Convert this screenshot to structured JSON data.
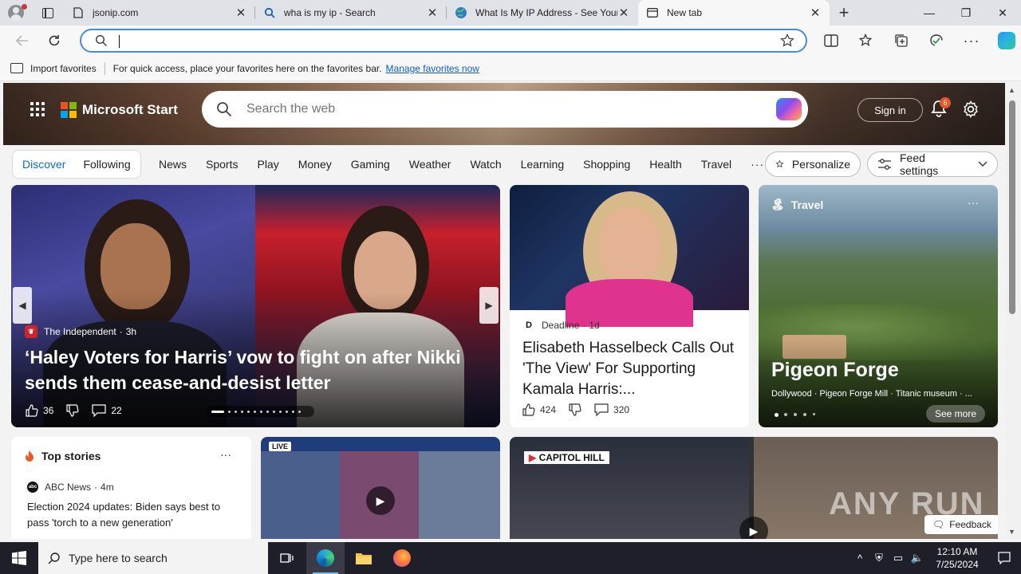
{
  "tabs": [
    {
      "title": "jsonip.com",
      "icon": "page-icon"
    },
    {
      "title": "wha is my ip - Search",
      "icon": "search-icon"
    },
    {
      "title": "What Is My IP Address - See Your",
      "icon": "globe-icon"
    },
    {
      "title": "New tab",
      "icon": "newtab-icon"
    }
  ],
  "address": {
    "value": ""
  },
  "favorites_bar": {
    "import_label": "Import favorites",
    "hint": "For quick access, place your favorites here on the favorites bar.",
    "manage_link": "Manage favorites now"
  },
  "header": {
    "brand": "Microsoft Start",
    "search_placeholder": "Search the web",
    "signin": "Sign in",
    "notif_count": "6"
  },
  "nav": {
    "pill": [
      "Discover",
      "Following"
    ],
    "categories": [
      "News",
      "Sports",
      "Play",
      "Money",
      "Gaming",
      "Weather",
      "Watch",
      "Learning",
      "Shopping",
      "Health",
      "Travel"
    ],
    "more": "···",
    "personalize": "Personalize",
    "feed_settings": "Feed settings"
  },
  "carousel": {
    "source": "The Independent",
    "age": "3h",
    "headline": "‘Haley Voters for Harris’ vow to fight on after Nikki sends them cease-and-desist letter",
    "likes": "36",
    "comments": "22"
  },
  "deadline_card": {
    "source": "Deadline",
    "age": "1d",
    "headline": "Elisabeth Hasselbeck Calls Out 'The View' For Supporting Kamala Harris:...",
    "likes": "424",
    "comments": "320"
  },
  "travel_card": {
    "label": "Travel",
    "place": "Pigeon Forge",
    "attractions": "Dollywood · Pigeon Forge Mill · Titanic museum · ...",
    "see_more": "See more"
  },
  "top_stories": {
    "label": "Top stories",
    "source": "ABC News",
    "age": "4m",
    "headline": "Election 2024 updates: Biden says best to pass 'torch to a new generation'"
  },
  "video1": {
    "badge": "LIVE"
  },
  "video2": {
    "badge": "CAPITOL HILL"
  },
  "watermark": "ANY RUN",
  "feedback": "Feedback",
  "taskbar": {
    "search_placeholder": "Type here to search",
    "time": "12:10 AM",
    "date": "7/25/2024"
  },
  "colors": {
    "accent": "#0f6cbd",
    "omnibox_border": "#4a8ad6",
    "taskbar": "#1f1f2a"
  }
}
